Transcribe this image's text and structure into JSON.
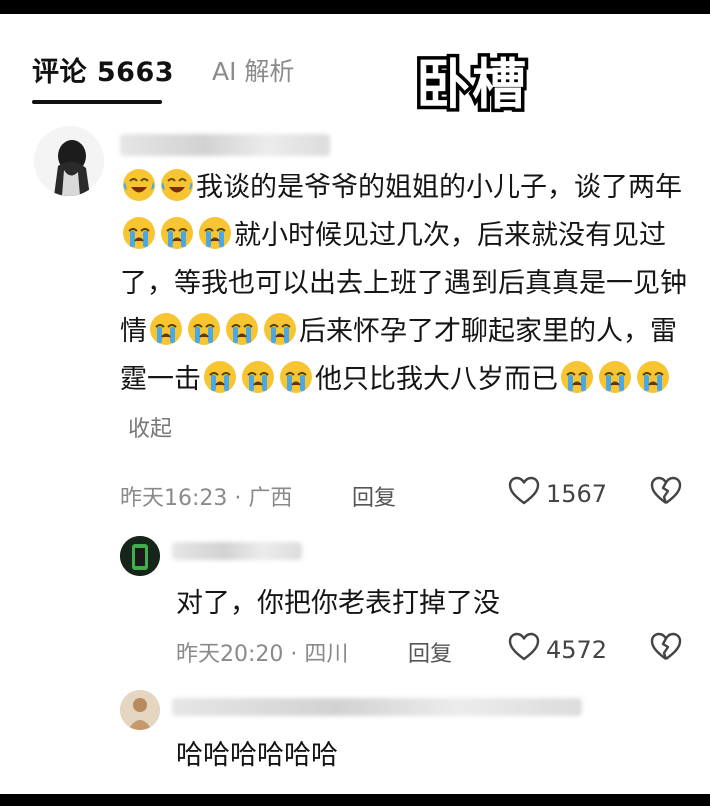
{
  "tabs": {
    "comments_label": "评论 5663",
    "ai_label": "AI 解析"
  },
  "sticker_text": "卧槽",
  "comments": [
    {
      "text_parts": [
        "我谈的是爷爷的姐姐的小儿子，谈了两年",
        "就小时候见过几次，后来就没有见过了，等我也可以出去上班了遇到后真真是一见钟情",
        "后来怀孕了才聊起家里的人，雷霆一击",
        "他只比我大八岁而已"
      ],
      "collapse_label": "收起",
      "time": "昨天16:23",
      "location": "广西",
      "reply_label": "回复",
      "likes": "1567"
    },
    {
      "text": "对了，你把你老表打掉了没",
      "time": "昨天20:20",
      "location": "四川",
      "reply_label": "回复",
      "likes": "4572"
    },
    {
      "text": "哈哈哈哈哈哈"
    }
  ],
  "colors": {
    "accent": "#111111",
    "muted": "#8a8a8a",
    "emoji_yellow": "#f7c531",
    "tear_blue": "#4aa8e8"
  },
  "icons": [
    "heart-icon",
    "broken-heart-icon",
    "crying-emoji-icon",
    "laughing-crying-emoji-icon"
  ]
}
